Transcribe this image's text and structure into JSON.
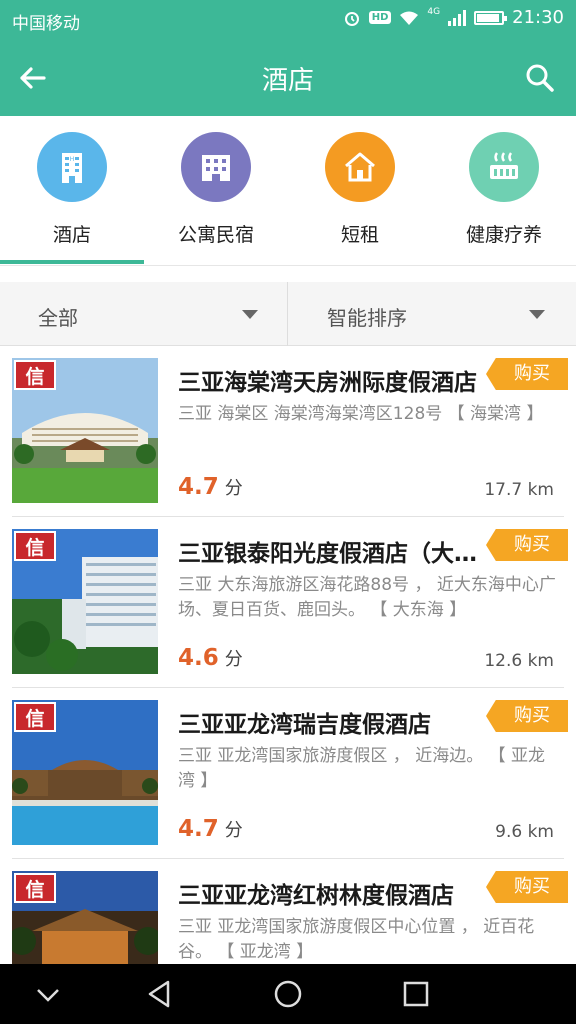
{
  "status_bar": {
    "carrier": "中国移动",
    "hd": "HD",
    "network": "4G",
    "time": "21:30"
  },
  "app_bar": {
    "title": "酒店",
    "back_icon": "arrow-left-icon",
    "search_icon": "search-icon"
  },
  "categories": [
    {
      "label": "酒店",
      "icon": "hotel-icon",
      "color": "#5ab6ea"
    },
    {
      "label": "公寓民宿",
      "icon": "apartment-icon",
      "color": "#7b78c0"
    },
    {
      "label": "短租",
      "icon": "house-icon",
      "color": "#f49b22"
    },
    {
      "label": "健康疗养",
      "icon": "spa-icon",
      "color": "#6fd0b2"
    }
  ],
  "filters": {
    "left": "全部",
    "right": "智能排序"
  },
  "hotels": [
    {
      "badge": "信",
      "name": "三亚海棠湾天房洲际度假酒店",
      "buy": "购买",
      "address": "三亚 海棠区 海棠湾海棠湾区128号 【 海棠湾 】",
      "score": "4.7",
      "score_unit": "分",
      "distance": "17.7 km"
    },
    {
      "badge": "信",
      "name": "三亚银泰阳光度假酒店（大东海）",
      "buy": "购买",
      "address": "三亚 大东海旅游区海花路88号 ， 近大东海中心广场、夏日百货、鹿回头。 【 大东海 】",
      "score": "4.6",
      "score_unit": "分",
      "distance": "12.6 km"
    },
    {
      "badge": "信",
      "name": "三亚亚龙湾瑞吉度假酒店",
      "buy": "购买",
      "address": "三亚 亚龙湾国家旅游度假区 ， 近海边。 【 亚龙湾 】",
      "score": "4.7",
      "score_unit": "分",
      "distance": "9.6 km"
    },
    {
      "badge": "信",
      "name": "三亚亚龙湾红树林度假酒店",
      "buy": "购买",
      "address": "三亚 亚龙湾国家旅游度假区中心位置 ， 近百花谷。 【 亚龙湾 】",
      "score": "",
      "score_unit": "",
      "distance": ""
    }
  ],
  "accent_color": "#3db897",
  "buy_color": "#f5a623",
  "score_color": "#e0622a"
}
